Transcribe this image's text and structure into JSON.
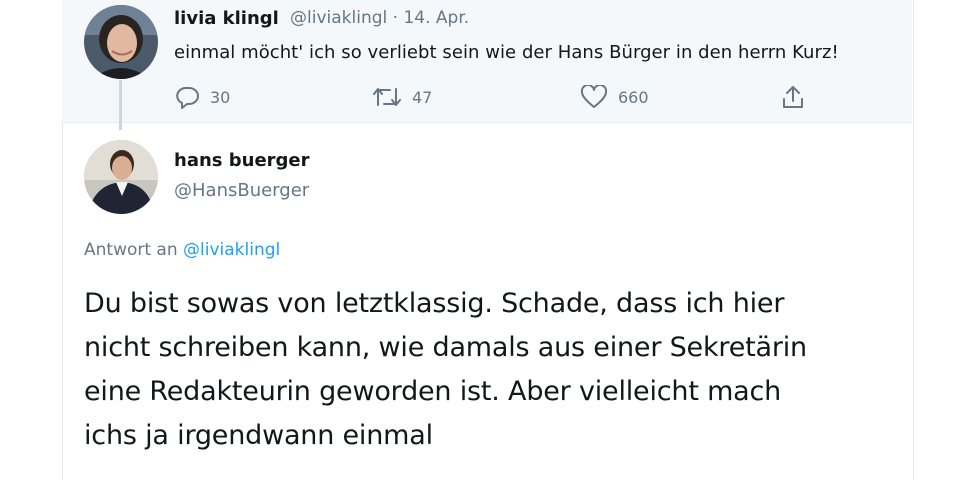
{
  "original_tweet": {
    "author_name": "livia klingl",
    "author_handle": "@liviaklingl",
    "separator": "·",
    "date": "14. Apr.",
    "text": "einmal möcht' ich so verliebt sein wie der Hans Bürger in den herrn Kurz!",
    "replies": "30",
    "retweets": "47",
    "likes": "660",
    "icons": [
      "reply-icon",
      "retweet-icon",
      "like-icon",
      "share-icon"
    ]
  },
  "reply_tweet": {
    "author_name": "hans buerger",
    "author_handle": "@HansBuerger",
    "reply_to_label": "Antwort an",
    "reply_to_handle": "@liviaklingl",
    "text_lines": [
      "Du bist sowas von letztklassig. Schade, dass ich hier",
      "nicht schreiben kann, wie damals aus einer Sekretärin",
      "eine Redakteurin geworden ist. Aber vielleicht mach",
      "ichs ja irgendwann einmal"
    ]
  },
  "colors": {
    "text": "#14171a",
    "muted": "#657786",
    "link": "#1da1f2",
    "thread_line": "#ccd6dd",
    "top_background": "#f5f8fa"
  }
}
